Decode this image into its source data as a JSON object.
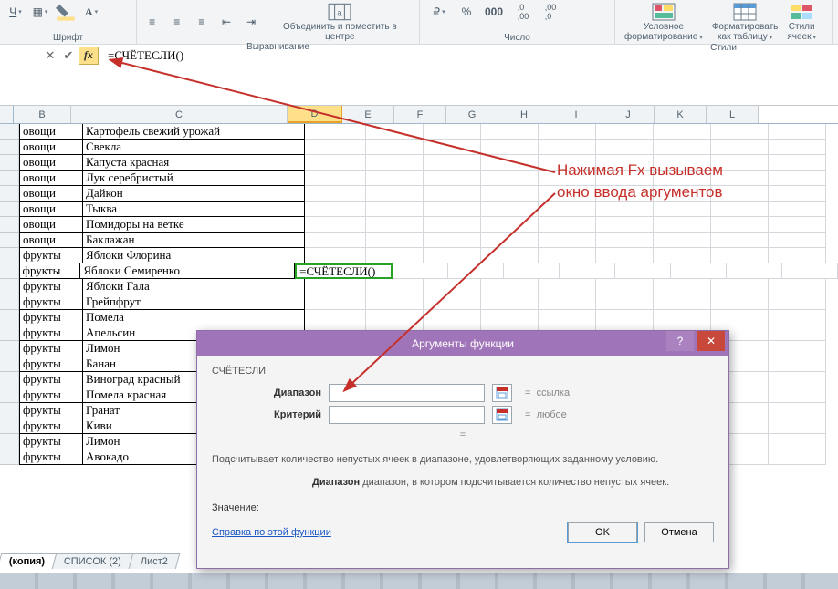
{
  "ribbon": {
    "font_group": "Шрифт",
    "align_group": "Выравнивание",
    "number_group": "Число",
    "styles_group": "Стили",
    "merge_label": "Объединить и поместить в центре",
    "cond_fmt_l1": "Условное",
    "cond_fmt_l2": "форматирование",
    "fmt_table_l1": "Форматировать",
    "fmt_table_l2": "как таблицу",
    "cell_styles_l1": "Стили",
    "cell_styles_l2": "ячеек"
  },
  "formula_bar": {
    "value": "=СЧЁТЕСЛИ()",
    "fx": "fx"
  },
  "columns": [
    "B",
    "C",
    "D",
    "E",
    "F",
    "G",
    "H",
    "I",
    "J",
    "K",
    "L"
  ],
  "rows": [
    {
      "b": "овощи",
      "c": "Картофель свежий урожай"
    },
    {
      "b": "овощи",
      "c": "Свекла"
    },
    {
      "b": "овощи",
      "c": "Капуста красная"
    },
    {
      "b": "овощи",
      "c": "Лук серебристый"
    },
    {
      "b": "овощи",
      "c": "Дайкон"
    },
    {
      "b": "овощи",
      "c": "Тыква"
    },
    {
      "b": "овощи",
      "c": "Помидоры на ветке"
    },
    {
      "b": "овощи",
      "c": "Баклажан"
    },
    {
      "b": "фрукты",
      "c": "Яблоки Флорина"
    },
    {
      "b": "фрукты",
      "c": "Яблоки Семиренко",
      "d": "=СЧЁТЕСЛИ()"
    },
    {
      "b": "фрукты",
      "c": "Яблоки Гала"
    },
    {
      "b": "фрукты",
      "c": "Грейпфрут"
    },
    {
      "b": "фрукты",
      "c": "Помела"
    },
    {
      "b": "фрукты",
      "c": "Апельсин"
    },
    {
      "b": "фрукты",
      "c": "Лимон"
    },
    {
      "b": "фрукты",
      "c": "Банан"
    },
    {
      "b": "фрукты",
      "c": "Виноград  красный"
    },
    {
      "b": "фрукты",
      "c": "Помела красная"
    },
    {
      "b": "фрукты",
      "c": "Гранат"
    },
    {
      "b": "фрукты",
      "c": "Киви"
    },
    {
      "b": "фрукты",
      "c": "Лимон"
    },
    {
      "b": "фрукты",
      "c": "Авокадо"
    }
  ],
  "tabs": {
    "t1": "(копия)",
    "t2": "СПИСОК (2)",
    "t3": "Лист2"
  },
  "dialog": {
    "title": "Аргументы функции",
    "func": "СЧЁТЕСЛИ",
    "arg1_label": "Диапазон",
    "arg2_label": "Критерий",
    "hint1": "ссылка",
    "hint2": "любое",
    "eq": "=",
    "desc1": "Подсчитывает количество непустых ячеек в диапазоне, удовлетворяющих заданному условию.",
    "desc2_b": "Диапазон",
    "desc2": "   диапазон, в котором подсчитывается количество непустых ячеек.",
    "value_label": "Значение:",
    "help_link": "Справка по этой функции",
    "ok": "OK",
    "cancel": "Отмена"
  },
  "annotation": {
    "l1": "Нажимая Fx вызываем",
    "l2": "окно ввода аргументов"
  }
}
